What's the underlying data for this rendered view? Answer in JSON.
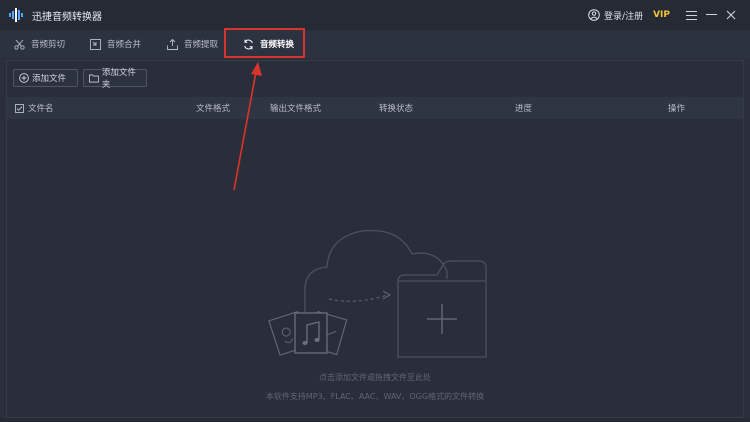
{
  "app": {
    "title": "迅捷音频转换器",
    "login_label": "登录/注册",
    "vip_label": "VIP"
  },
  "tabs": [
    {
      "label": "音频剪切",
      "icon": "scissors-icon"
    },
    {
      "label": "音频合并",
      "icon": "merge-icon"
    },
    {
      "label": "音频提取",
      "icon": "extract-icon"
    },
    {
      "label": "音频转换",
      "icon": "convert-icon",
      "active": true
    }
  ],
  "toolbar": {
    "add_file_label": "添加文件",
    "add_folder_label": "添加文件夹"
  },
  "table": {
    "columns": [
      "文件名",
      "文件格式",
      "输出文件格式",
      "转换状态",
      "进度",
      "操作"
    ]
  },
  "empty_state": {
    "hint_primary": "点击添加文件或拖拽文件至此处",
    "hint_secondary": "本软件支持MP3、FLAC、AAC、WAV、OGG格式的文件转换"
  },
  "colors": {
    "titlebar": "#262a35",
    "background": "#2b2f3b",
    "vip": "#f4c430",
    "highlight": "#d9342b"
  }
}
